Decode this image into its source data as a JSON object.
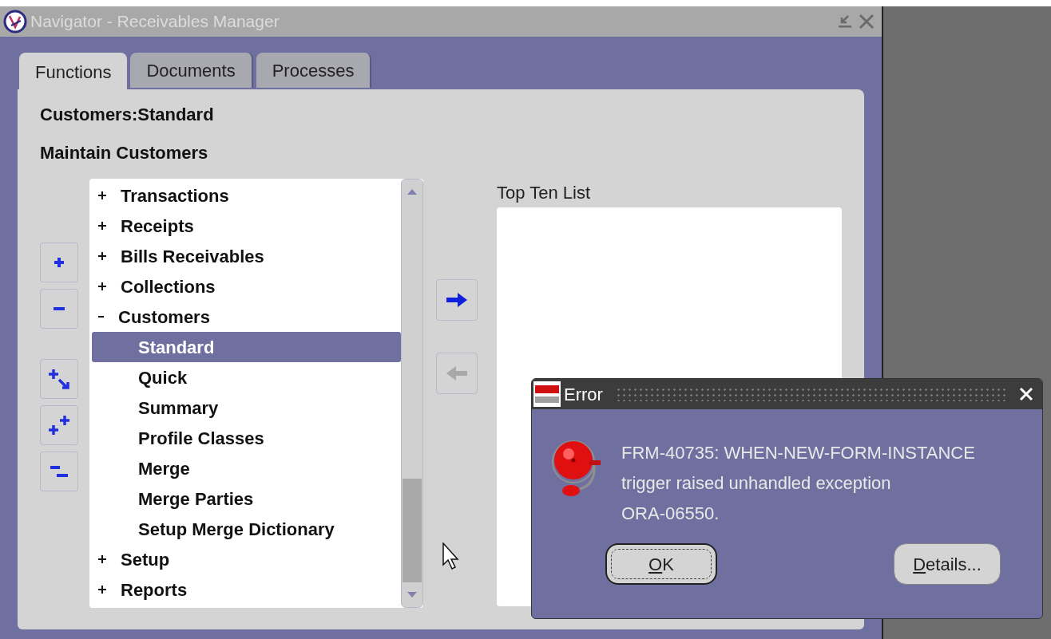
{
  "window": {
    "title": "Navigator - Receivables Manager"
  },
  "tabs": [
    {
      "label": "Functions",
      "selected": true
    },
    {
      "label": "Documents",
      "selected": false
    },
    {
      "label": "Processes",
      "selected": false
    }
  ],
  "function_title": "Customers:Standard",
  "function_description": "Maintain Customers",
  "tree": [
    {
      "label": "Transactions",
      "expanded": false,
      "selected": false
    },
    {
      "label": "Receipts",
      "expanded": false,
      "selected": false
    },
    {
      "label": "Bills Receivables",
      "expanded": false,
      "selected": false
    },
    {
      "label": "Collections",
      "expanded": false,
      "selected": false
    },
    {
      "label": "Customers",
      "expanded": true,
      "selected": false,
      "children": [
        {
          "label": "Standard",
          "selected": true
        },
        {
          "label": "Quick",
          "selected": false
        },
        {
          "label": "Summary",
          "selected": false
        },
        {
          "label": "Profile Classes",
          "selected": false
        },
        {
          "label": "Merge",
          "selected": false
        },
        {
          "label": "Merge Parties",
          "selected": false
        },
        {
          "label": "Setup Merge Dictionary",
          "selected": false
        }
      ]
    },
    {
      "label": "Setup",
      "expanded": false,
      "selected": false
    },
    {
      "label": "Reports",
      "expanded": false,
      "selected": false
    }
  ],
  "add_button": {
    "disabled": false
  },
  "remove_button": {
    "disabled": true
  },
  "top_ten": {
    "label": "Top Ten List"
  },
  "dialog": {
    "title": "Error",
    "message": [
      "FRM-40735: WHEN-NEW-FORM-INSTANCE",
      "trigger raised unhandled exception",
      "ORA-06550."
    ],
    "buttons": [
      {
        "label": "OK",
        "default": true,
        "mnemonic": true
      },
      {
        "label": "Details...",
        "default": false,
        "mnemonic": true
      }
    ]
  }
}
